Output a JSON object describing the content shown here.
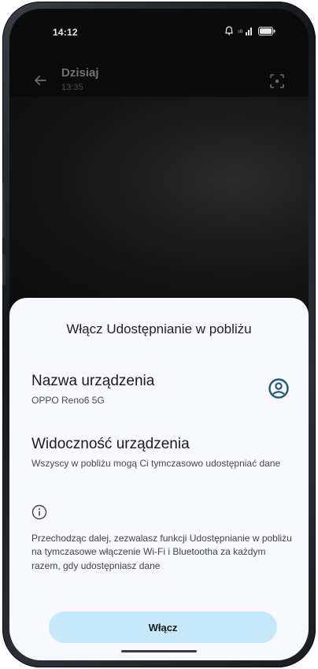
{
  "status_bar": {
    "time": "14:12"
  },
  "app_header": {
    "title": "Dzisiaj",
    "subtitle": "13:35"
  },
  "sheet": {
    "title": "Włącz Udostępnianie w pobliżu",
    "device_name": {
      "heading": "Nazwa urządzenia",
      "value": "OPPO Reno6 5G"
    },
    "visibility": {
      "heading": "Widoczność urządzenia",
      "value": "Wszyscy w pobliżu mogą Ci tymczasowo udostępniać dane"
    },
    "disclaimer": "Przechodząc dalej, zezwalasz funkcji Udostępnianie w pobliżu na tymczasowe włączenie Wi-Fi i Bluetootha za każdym razem, gdy udostępniasz dane",
    "enable_button": "Włącz"
  },
  "colors": {
    "sheet_background": "#f7f9fe",
    "button_background": "#c5e8fb",
    "accent_icon": "#1f5c78"
  },
  "icons": {
    "back": "back-arrow-icon",
    "scan": "scan-icon",
    "account": "account-circle-icon",
    "info": "info-icon",
    "alarm": "alarm-icon",
    "signal": "signal-icon",
    "battery": "battery-icon"
  }
}
